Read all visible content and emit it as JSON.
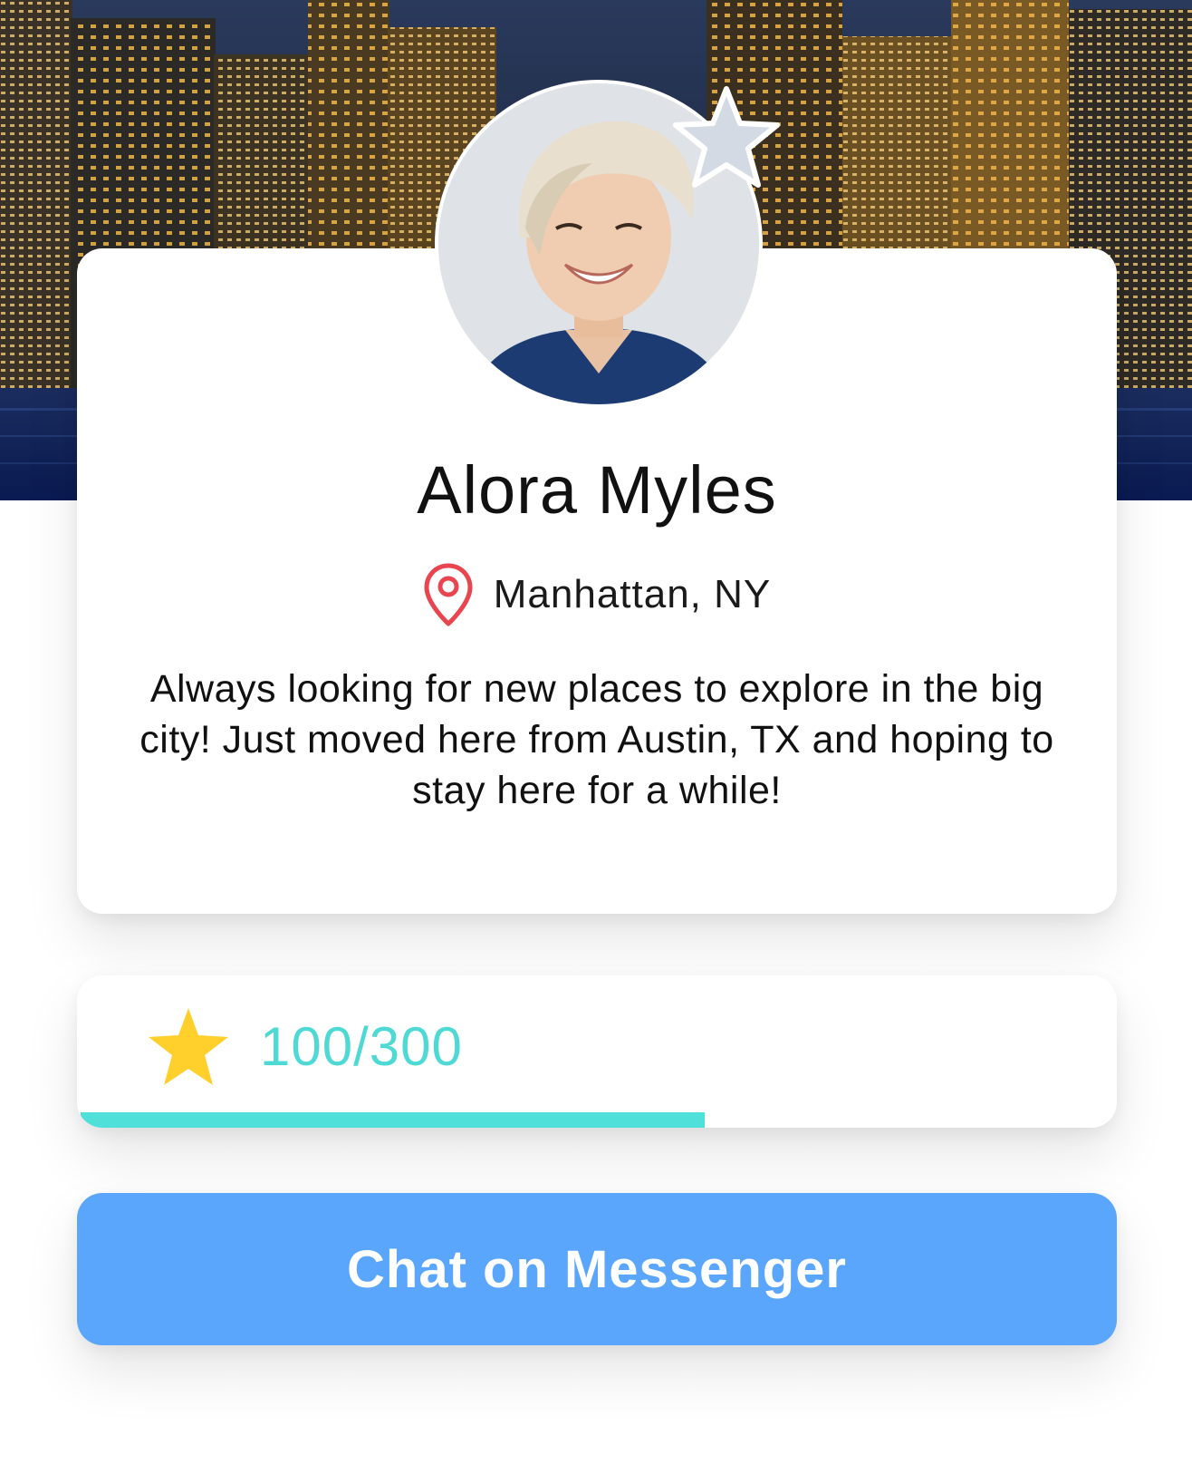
{
  "profile": {
    "name": "Alora Myles",
    "location": "Manhattan, NY",
    "bio": "Always looking for new places to explore in the big city! Just moved here from Austin, TX and hoping to stay here for a while!",
    "featured_badge_icon": "star-badge-icon",
    "location_icon": "map-pin-icon"
  },
  "points": {
    "display": "100/300",
    "current": 100,
    "total": 300,
    "progress_fraction": 0.6,
    "icon": "star-icon"
  },
  "actions": {
    "chat_label": "Chat on Messenger"
  },
  "colors": {
    "accent_teal": "#4fe0d9",
    "points_text": "#4fd9d4",
    "button_blue": "#5aa6fd",
    "pin_red": "#e8454f",
    "star_gold": "#ffd02b",
    "badge_star_grey": "#d4dae3"
  }
}
